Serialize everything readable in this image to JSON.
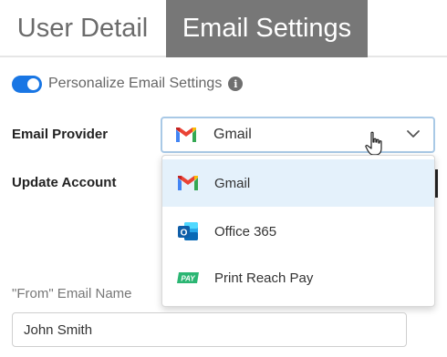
{
  "tabs": [
    {
      "label": "User Detail",
      "active": false
    },
    {
      "label": "Email Settings",
      "active": true
    }
  ],
  "toggle": {
    "label": "Personalize Email Settings",
    "on": true
  },
  "form": {
    "provider_label": "Email Provider",
    "update_label": "Update Account",
    "from_label": "\"From\" Email Name",
    "from_value": "John Smith"
  },
  "select": {
    "value": "Gmail",
    "icon": "gmail-icon"
  },
  "dropdown": {
    "options": [
      {
        "label": "Gmail",
        "icon": "gmail-icon",
        "highlighted": true
      },
      {
        "label": "Office 365",
        "icon": "office365-icon",
        "highlighted": false
      },
      {
        "label": "Print Reach Pay",
        "icon": "print-reach-pay-icon",
        "highlighted": false
      }
    ]
  },
  "colors": {
    "active_tab_bg": "#777777",
    "toggle_on": "#1976e4",
    "highlight": "#e4f1fb",
    "focus_border": "#a9c9e6"
  }
}
